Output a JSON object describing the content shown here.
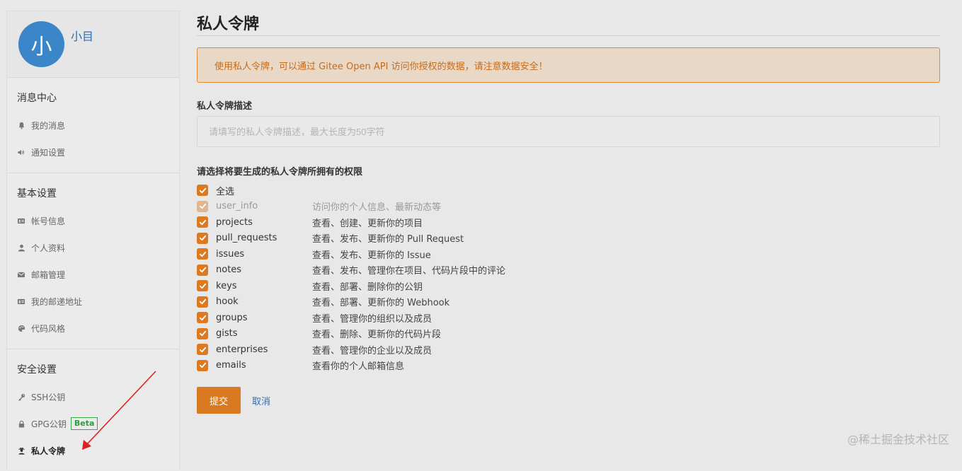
{
  "profile": {
    "avatar_char": "小",
    "name": "小目"
  },
  "sidebar": {
    "sections": [
      {
        "title": "消息中心",
        "items": [
          {
            "icon": "bell-icon",
            "label": "我的消息"
          },
          {
            "icon": "speaker-icon",
            "label": "通知设置"
          }
        ]
      },
      {
        "title": "基本设置",
        "items": [
          {
            "icon": "id-card-icon",
            "label": "帐号信息"
          },
          {
            "icon": "user-icon",
            "label": "个人资料"
          },
          {
            "icon": "envelope-icon",
            "label": "邮箱管理"
          },
          {
            "icon": "id-card-icon",
            "label": "我的邮递地址"
          },
          {
            "icon": "palette-icon",
            "label": "代码风格"
          }
        ]
      },
      {
        "title": "安全设置",
        "items": [
          {
            "icon": "key-icon",
            "label": "SSH公钥"
          },
          {
            "icon": "lock-icon",
            "label": "GPG公钥",
            "badge": "Beta"
          },
          {
            "icon": "user-secret-icon",
            "label": "私人令牌",
            "active": true
          }
        ]
      }
    ]
  },
  "main": {
    "title": "私人令牌",
    "alert": "使用私人令牌，可以通过 Gitee Open API 访问你授权的数据，请注意数据安全！",
    "desc_label": "私人令牌描述",
    "desc_placeholder": "请填写的私人令牌描述，最大长度为50字符",
    "perm_title": "请选择将要生成的私人令牌所拥有的权限",
    "select_all": "全选",
    "permissions": [
      {
        "name": "user_info",
        "desc": "访问你的个人信息、最新动态等",
        "disabled": true
      },
      {
        "name": "projects",
        "desc": "查看、创建、更新你的项目"
      },
      {
        "name": "pull_requests",
        "desc": "查看、发布、更新你的 Pull Request"
      },
      {
        "name": "issues",
        "desc": "查看、发布、更新你的 Issue"
      },
      {
        "name": "notes",
        "desc": "查看、发布、管理你在项目、代码片段中的评论"
      },
      {
        "name": "keys",
        "desc": "查看、部署、删除你的公钥"
      },
      {
        "name": "hook",
        "desc": "查看、部署、更新你的 Webhook"
      },
      {
        "name": "groups",
        "desc": "查看、管理你的组织以及成员"
      },
      {
        "name": "gists",
        "desc": "查看、删除、更新你的代码片段"
      },
      {
        "name": "enterprises",
        "desc": "查看、管理你的企业以及成员"
      },
      {
        "name": "emails",
        "desc": "查看你的个人邮箱信息"
      }
    ],
    "submit_label": "提交",
    "cancel_label": "取消"
  },
  "watermark": "@稀土掘金技术社区",
  "colors": {
    "accent": "#d97a20",
    "link": "#2f6fb0",
    "beta": "#2e9a44",
    "annotation_arrow": "#e02020"
  }
}
